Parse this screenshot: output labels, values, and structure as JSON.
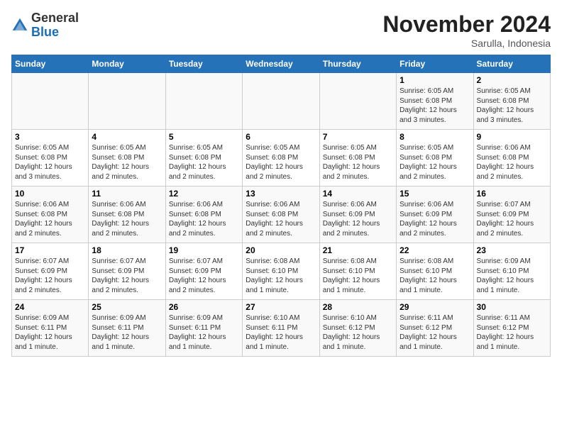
{
  "header": {
    "logo_general": "General",
    "logo_blue": "Blue",
    "month_title": "November 2024",
    "subtitle": "Sarulla, Indonesia"
  },
  "days_of_week": [
    "Sunday",
    "Monday",
    "Tuesday",
    "Wednesday",
    "Thursday",
    "Friday",
    "Saturday"
  ],
  "weeks": [
    [
      {
        "day": "",
        "info": ""
      },
      {
        "day": "",
        "info": ""
      },
      {
        "day": "",
        "info": ""
      },
      {
        "day": "",
        "info": ""
      },
      {
        "day": "",
        "info": ""
      },
      {
        "day": "1",
        "info": "Sunrise: 6:05 AM\nSunset: 6:08 PM\nDaylight: 12 hours\nand 3 minutes."
      },
      {
        "day": "2",
        "info": "Sunrise: 6:05 AM\nSunset: 6:08 PM\nDaylight: 12 hours\nand 3 minutes."
      }
    ],
    [
      {
        "day": "3",
        "info": "Sunrise: 6:05 AM\nSunset: 6:08 PM\nDaylight: 12 hours\nand 3 minutes."
      },
      {
        "day": "4",
        "info": "Sunrise: 6:05 AM\nSunset: 6:08 PM\nDaylight: 12 hours\nand 2 minutes."
      },
      {
        "day": "5",
        "info": "Sunrise: 6:05 AM\nSunset: 6:08 PM\nDaylight: 12 hours\nand 2 minutes."
      },
      {
        "day": "6",
        "info": "Sunrise: 6:05 AM\nSunset: 6:08 PM\nDaylight: 12 hours\nand 2 minutes."
      },
      {
        "day": "7",
        "info": "Sunrise: 6:05 AM\nSunset: 6:08 PM\nDaylight: 12 hours\nand 2 minutes."
      },
      {
        "day": "8",
        "info": "Sunrise: 6:05 AM\nSunset: 6:08 PM\nDaylight: 12 hours\nand 2 minutes."
      },
      {
        "day": "9",
        "info": "Sunrise: 6:06 AM\nSunset: 6:08 PM\nDaylight: 12 hours\nand 2 minutes."
      }
    ],
    [
      {
        "day": "10",
        "info": "Sunrise: 6:06 AM\nSunset: 6:08 PM\nDaylight: 12 hours\nand 2 minutes."
      },
      {
        "day": "11",
        "info": "Sunrise: 6:06 AM\nSunset: 6:08 PM\nDaylight: 12 hours\nand 2 minutes."
      },
      {
        "day": "12",
        "info": "Sunrise: 6:06 AM\nSunset: 6:08 PM\nDaylight: 12 hours\nand 2 minutes."
      },
      {
        "day": "13",
        "info": "Sunrise: 6:06 AM\nSunset: 6:08 PM\nDaylight: 12 hours\nand 2 minutes."
      },
      {
        "day": "14",
        "info": "Sunrise: 6:06 AM\nSunset: 6:09 PM\nDaylight: 12 hours\nand 2 minutes."
      },
      {
        "day": "15",
        "info": "Sunrise: 6:06 AM\nSunset: 6:09 PM\nDaylight: 12 hours\nand 2 minutes."
      },
      {
        "day": "16",
        "info": "Sunrise: 6:07 AM\nSunset: 6:09 PM\nDaylight: 12 hours\nand 2 minutes."
      }
    ],
    [
      {
        "day": "17",
        "info": "Sunrise: 6:07 AM\nSunset: 6:09 PM\nDaylight: 12 hours\nand 2 minutes."
      },
      {
        "day": "18",
        "info": "Sunrise: 6:07 AM\nSunset: 6:09 PM\nDaylight: 12 hours\nand 2 minutes."
      },
      {
        "day": "19",
        "info": "Sunrise: 6:07 AM\nSunset: 6:09 PM\nDaylight: 12 hours\nand 2 minutes."
      },
      {
        "day": "20",
        "info": "Sunrise: 6:08 AM\nSunset: 6:10 PM\nDaylight: 12 hours\nand 1 minute."
      },
      {
        "day": "21",
        "info": "Sunrise: 6:08 AM\nSunset: 6:10 PM\nDaylight: 12 hours\nand 1 minute."
      },
      {
        "day": "22",
        "info": "Sunrise: 6:08 AM\nSunset: 6:10 PM\nDaylight: 12 hours\nand 1 minute."
      },
      {
        "day": "23",
        "info": "Sunrise: 6:09 AM\nSunset: 6:10 PM\nDaylight: 12 hours\nand 1 minute."
      }
    ],
    [
      {
        "day": "24",
        "info": "Sunrise: 6:09 AM\nSunset: 6:11 PM\nDaylight: 12 hours\nand 1 minute."
      },
      {
        "day": "25",
        "info": "Sunrise: 6:09 AM\nSunset: 6:11 PM\nDaylight: 12 hours\nand 1 minute."
      },
      {
        "day": "26",
        "info": "Sunrise: 6:09 AM\nSunset: 6:11 PM\nDaylight: 12 hours\nand 1 minute."
      },
      {
        "day": "27",
        "info": "Sunrise: 6:10 AM\nSunset: 6:11 PM\nDaylight: 12 hours\nand 1 minute."
      },
      {
        "day": "28",
        "info": "Sunrise: 6:10 AM\nSunset: 6:12 PM\nDaylight: 12 hours\nand 1 minute."
      },
      {
        "day": "29",
        "info": "Sunrise: 6:11 AM\nSunset: 6:12 PM\nDaylight: 12 hours\nand 1 minute."
      },
      {
        "day": "30",
        "info": "Sunrise: 6:11 AM\nSunset: 6:12 PM\nDaylight: 12 hours\nand 1 minute."
      }
    ]
  ]
}
